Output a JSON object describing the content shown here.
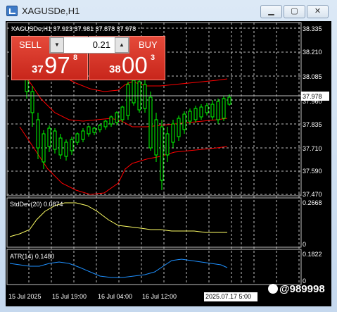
{
  "window": {
    "title": "XAGUSDe,H1",
    "controls": {
      "minimize": "▁",
      "maximize": "▢",
      "close": "✕"
    }
  },
  "chart": {
    "header": "XAGUSDe,H1  37.923 37.981 37.878 37.978",
    "price_axis": [
      "38.335",
      "38.210",
      "38.085",
      "37.960",
      "37.835",
      "37.710",
      "37.590",
      "37.470"
    ],
    "current_price": "37.978",
    "time_axis": [
      "15 Jul 2025",
      "15 Jul 19:00",
      "16 Jul 04:00",
      "16 Jul 12:00",
      "2025.07.17 5:00"
    ],
    "colors": {
      "background": "#000000",
      "bull": "#00ff00",
      "bear": "#00ff00",
      "bands": "#ff0000",
      "grid": "#c0c0c0",
      "stddev": "#ffff66",
      "atr": "#1e90ff"
    }
  },
  "one_click": {
    "sell_label": "SELL",
    "buy_label": "BUY",
    "lot": "0.21",
    "sell_price": {
      "prefix": "37",
      "big": "97",
      "sup": "8"
    },
    "buy_price": {
      "prefix": "38",
      "big": "00",
      "sup": "3"
    }
  },
  "stddev": {
    "label": "StdDev(20) 0.0874",
    "scale": [
      "0.2668",
      "0"
    ]
  },
  "atr": {
    "label": "ATR(14) 0.1480",
    "scale": [
      "0.1822",
      "0"
    ]
  },
  "watermark": {
    "text": "@989998"
  }
}
